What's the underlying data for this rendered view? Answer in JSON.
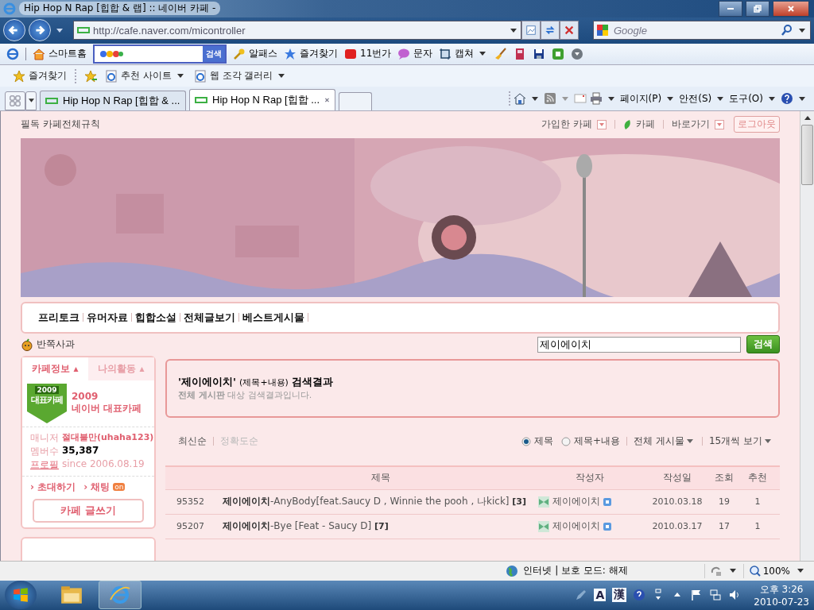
{
  "window": {
    "title": "Hip Hop N Rap [힙합 & 랩] :: 네이버 카페 -"
  },
  "address_bar": {
    "url": "http://cafe.naver.com/micontroller"
  },
  "search_box": {
    "placeholder": "Google"
  },
  "toolbar": {
    "home": "스마트홈",
    "search_button": "검색",
    "items": [
      {
        "kind": "key",
        "label": "알패스"
      },
      {
        "kind": "star",
        "label": "즐겨찾기"
      },
      {
        "kind": "shop",
        "label": "11번가"
      },
      {
        "kind": "chat",
        "label": "문자"
      },
      {
        "kind": "capture",
        "label": "캡쳐"
      }
    ]
  },
  "favorites_bar": {
    "favorites": "즐겨찾기",
    "items": [
      "추천 사이트",
      "웹 조각 갤러리"
    ]
  },
  "tabs": [
    {
      "label": "Hip Hop N Rap [힙합 & ...",
      "selected": false
    },
    {
      "label": "Hip Hop N Rap [힙합 ...",
      "selected": true
    }
  ],
  "command_bar": [
    "페이지(P)",
    "안전(S)",
    "도구(O)"
  ],
  "cafe_header": {
    "rules": "필독 카페전체규칙",
    "links": [
      "가입한 카페",
      "카페",
      "바로가기"
    ],
    "logout": "로그아웃"
  },
  "nav_menu": [
    "프리토크",
    "유머자료",
    "힙합소설",
    "전체글보기",
    "베스트게시물"
  ],
  "apple_label": "반쪽사과",
  "cafe_search": {
    "value": "제이에이치",
    "button": "검색"
  },
  "sidebar": {
    "tabs": [
      {
        "label": "카페정보 ▴",
        "selected": true
      },
      {
        "label": "나의활동 ▴",
        "selected": false
      }
    ],
    "emblem": {
      "year": "2009",
      "label": "대표카페"
    },
    "award": {
      "year": "2009",
      "title": "네이버 대표카페"
    },
    "info": [
      {
        "label": "매니저",
        "value": "절대불만(uhaha123)"
      },
      {
        "label": "멤버수",
        "value": "35,387"
      },
      {
        "label": "프로필",
        "value": "since 2006.08.19"
      }
    ],
    "invite": "› 초대하기",
    "chat": "› 채팅",
    "chat_badge": "on",
    "write_button": "카페 글쓰기"
  },
  "result_box": {
    "query": "'제이에이치'",
    "scope": "(제목+내용)",
    "suffix": "검색결과",
    "board": "전체 게시판",
    "note": "대상 검색결과입니다."
  },
  "sort": [
    {
      "label": "최신순",
      "selected": true
    },
    {
      "label": "정확도순",
      "selected": false
    }
  ],
  "filter": {
    "radios": [
      {
        "label": "제목",
        "selected": true
      },
      {
        "label": "제목+내용",
        "selected": false
      }
    ],
    "dropdowns": [
      "전체 게시물",
      "15개씩 보기"
    ]
  },
  "table": {
    "columns": [
      "제목",
      "작성자",
      "작성일",
      "조회",
      "추천"
    ],
    "rows": [
      {
        "number": "95352",
        "keyword": "제이에이치",
        "title": "-AnyBody[feat.Saucy D , Winnie the pooh , 나kick]",
        "comments": "[3]",
        "author": "제이에이치",
        "date": "2010.03.18",
        "views": "19",
        "likes": "1"
      },
      {
        "number": "95207",
        "keyword": "제이에이치",
        "title": "-Bye [Feat - Saucy D]",
        "comments": "[7]",
        "author": "제이에이치",
        "date": "2010.03.17",
        "views": "17",
        "likes": "1"
      }
    ]
  },
  "status_bar": {
    "zone": "인터넷 | 보호 모드: 해제",
    "zoom": "100%"
  },
  "taskbar": {
    "ime": [
      "A",
      "漢"
    ],
    "time": "오후 3:26",
    "date": "2010-07-23"
  }
}
